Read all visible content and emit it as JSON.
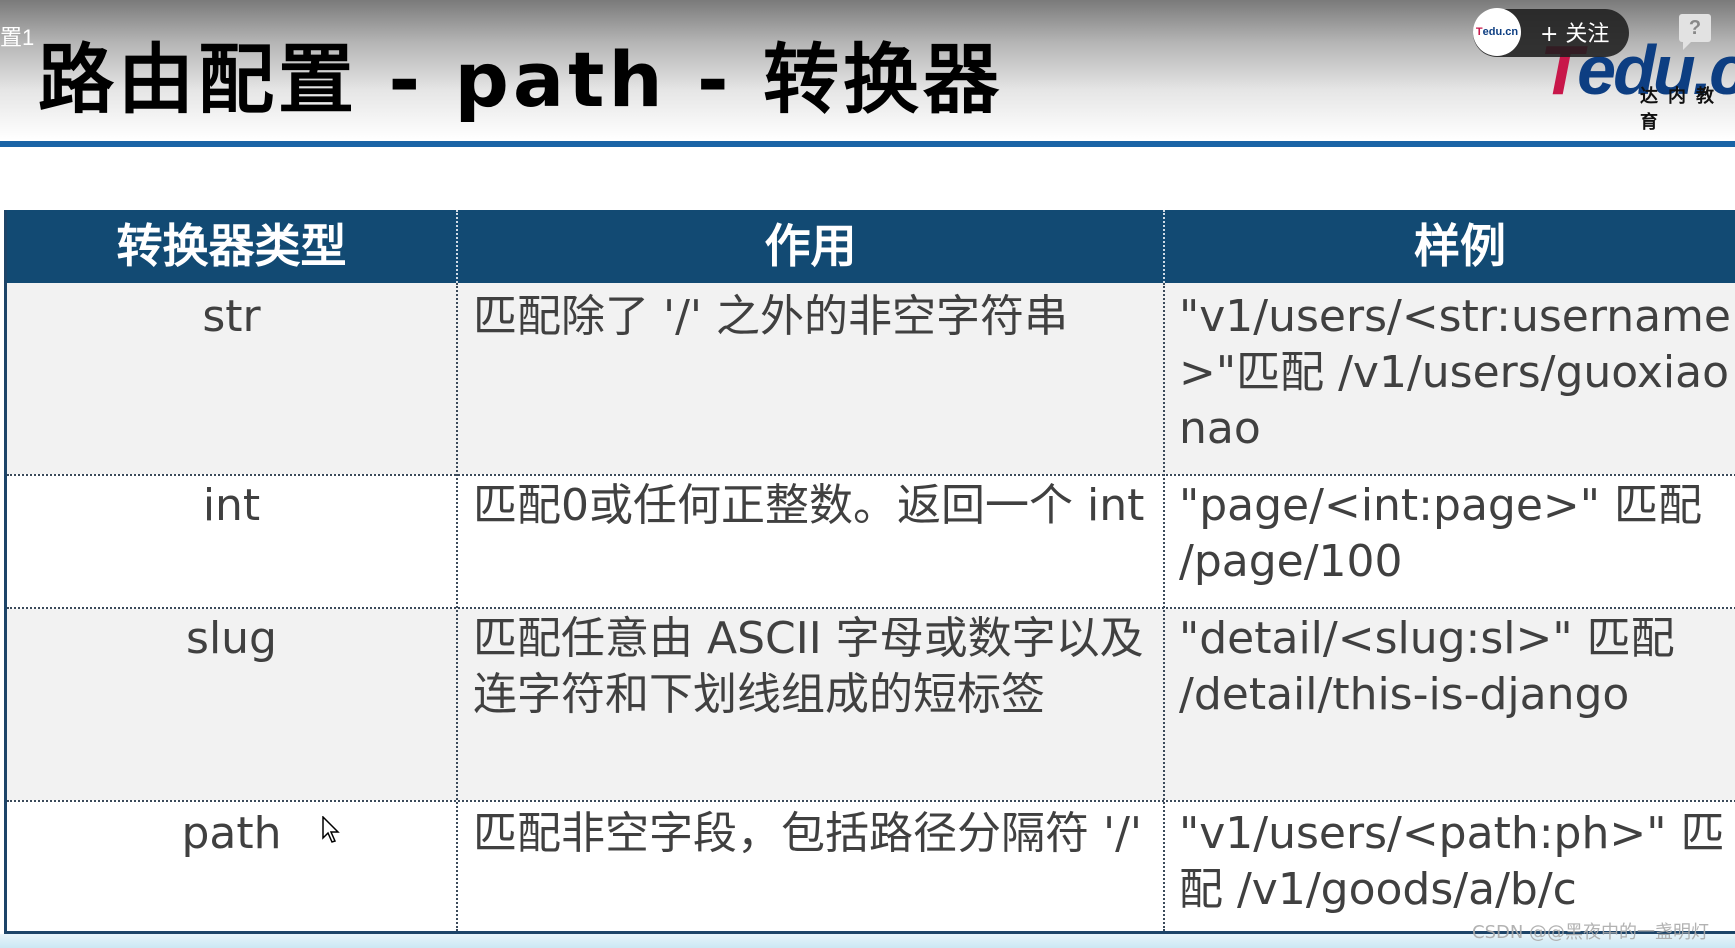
{
  "header": {
    "prev_tab_fragment": "置1",
    "title": "路由配置 - path - 转换器",
    "logo": {
      "t": "T",
      "rest": "edu.cn",
      "subtitle": "达内教育"
    },
    "follow": {
      "avatar_t": "T",
      "avatar_rest": "edu.cn",
      "label": "+ 关注"
    },
    "help": "?"
  },
  "table": {
    "columns": [
      "转换器类型",
      "作用",
      "样例"
    ],
    "rows": [
      {
        "type": "str",
        "purpose": "匹配除了 '/' 之外的非空字符串",
        "example": "\"v1/users/<str:username>\"匹配 /v1/users/guoxiaonao"
      },
      {
        "type": "int",
        "purpose": "匹配0或任何正整数。返回一个 int",
        "example": "\"page/<int:page>\" 匹配 /page/100"
      },
      {
        "type": "slug",
        "purpose": "匹配任意由 ASCII 字母或数字以及连字符和下划线组成的短标签",
        "example": "\"detail/<slug:sl>\" 匹配 /detail/this-is-django"
      },
      {
        "type": "path",
        "purpose": "匹配非空字段，包括路径分隔符 '/'",
        "example": "\"v1/users/<path:ph>\" 匹配 /v1/goods/a/b/c"
      }
    ]
  },
  "watermark": "CSDN @@黑夜中的一盏明灯",
  "colors": {
    "header_bg": "#124a73",
    "title_rule": "#1a64a6",
    "logo_red": "#c8174a",
    "logo_blue": "#0d3e82",
    "row_shade": "#f2f2f2",
    "cell_text": "#404040"
  }
}
